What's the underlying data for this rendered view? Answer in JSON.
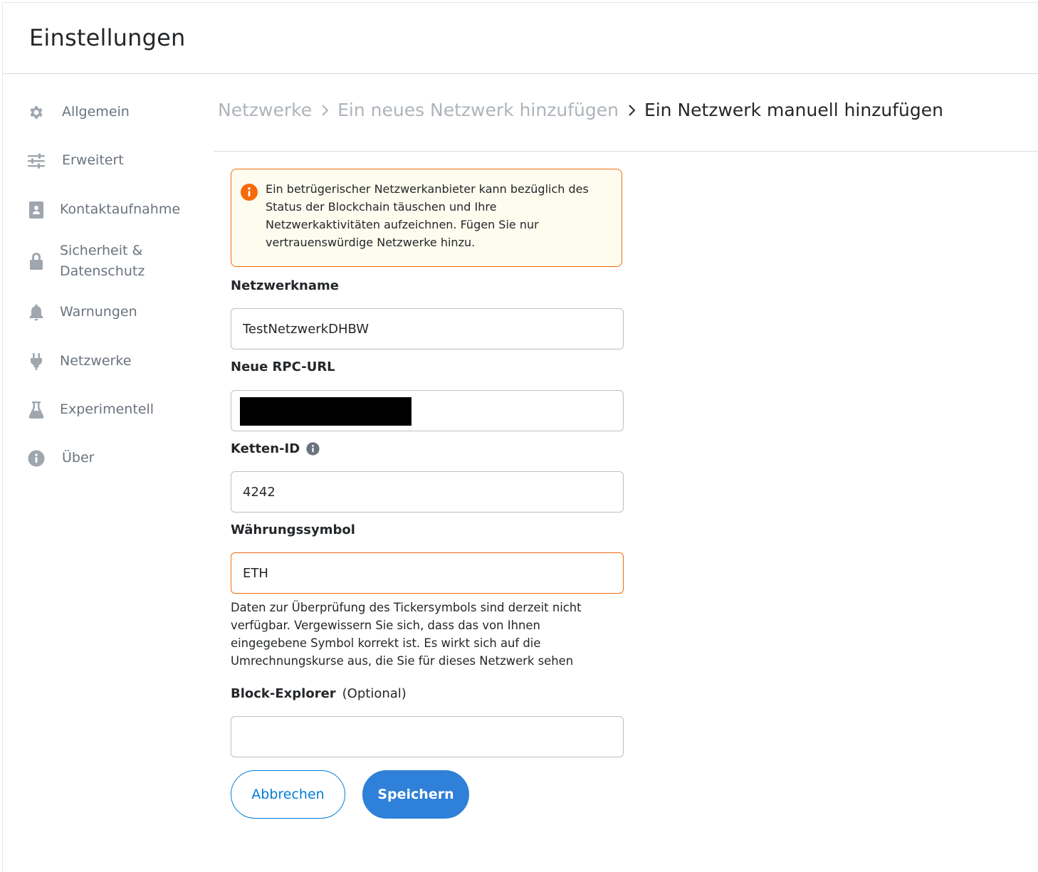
{
  "header": {
    "title": "Einstellungen"
  },
  "sidebar": {
    "items": [
      {
        "label": "Allgemein",
        "icon": "gear-icon"
      },
      {
        "label": "Erweitert",
        "icon": "sliders-icon"
      },
      {
        "label": "Kontaktaufnahme",
        "icon": "contact-book-icon"
      },
      {
        "label": "Sicherheit & Datenschutz",
        "icon": "lock-icon"
      },
      {
        "label": "Warnungen",
        "icon": "bell-icon"
      },
      {
        "label": "Netzwerke",
        "icon": "plug-icon"
      },
      {
        "label": "Experimentell",
        "icon": "flask-icon"
      },
      {
        "label": "Über",
        "icon": "info-icon"
      }
    ]
  },
  "breadcrumb": {
    "items": [
      "Netzwerke",
      "Ein neues Netzwerk hinzufügen",
      "Ein Netzwerk manuell hinzufügen"
    ],
    "separator": "chevron-right-icon"
  },
  "warning": {
    "icon": "warning-icon",
    "text": "Ein betrügerischer Netzwerkanbieter kann bezüglich des Status der Blockchain täuschen und Ihre Netzwerkaktivitäten aufzeichnen. Fügen Sie nur vertrauenswürdige Netzwerke hinzu."
  },
  "form": {
    "network_name": {
      "label": "Netzwerkname",
      "value": "TestNetzwerkDHBW"
    },
    "rpc_url": {
      "label": "Neue RPC-URL",
      "value": ""
    },
    "chain_id": {
      "label": "Ketten-ID",
      "value": "4242"
    },
    "currency_symbol": {
      "label": "Währungssymbol",
      "value": "ETH",
      "help": "Daten zur Überprüfung des Tickersymbols sind derzeit nicht verfügbar. Vergewissern Sie sich, dass das von Ihnen eingegebene Symbol korrekt ist. Es wirkt sich auf die Umrechnungskurse aus, die Sie für dieses Netzwerk sehen"
    },
    "block_explorer": {
      "label": "Block-Explorer",
      "optional": "(Optional)",
      "value": ""
    }
  },
  "buttons": {
    "cancel": "Abbrechen",
    "save": "Speichern"
  },
  "colors": {
    "primary": "#037dd6",
    "save_bg": "#2f80d8",
    "warning_border": "#f66a0a",
    "warning_bg": "#fefcef",
    "muted_text": "#aeb4ba"
  }
}
